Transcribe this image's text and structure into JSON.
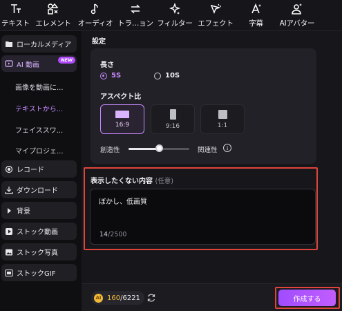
{
  "toolbar": {
    "items": [
      {
        "label": "テキスト",
        "icon": "text-icon"
      },
      {
        "label": "エレメント",
        "icon": "elements-icon"
      },
      {
        "label": "オーディオ",
        "icon": "music-note-icon"
      },
      {
        "label": "トラ…ョン",
        "icon": "transition-icon"
      },
      {
        "label": "フィルター",
        "icon": "sparkle-icon"
      },
      {
        "label": "エフェクト",
        "icon": "effect-icon"
      },
      {
        "label": "字幕",
        "icon": "caption-icon"
      },
      {
        "label": "AIアバター",
        "icon": "avatar-icon"
      }
    ]
  },
  "sidebar": {
    "items": [
      {
        "label": "ローカルメディア",
        "icon": "folder-icon"
      },
      {
        "label": "AI 動画",
        "icon": "ai-video-icon",
        "badge": "NEW"
      },
      {
        "label": "レコード",
        "icon": "record-icon"
      },
      {
        "label": "ダウンロード",
        "icon": "download-icon"
      },
      {
        "label": "背景",
        "icon": "caret-right-icon"
      },
      {
        "label": "ストック動画",
        "icon": "play-icon"
      },
      {
        "label": "ストック写真",
        "icon": "image-icon"
      },
      {
        "label": "ストックGIF",
        "icon": "gif-icon"
      }
    ],
    "subitems": [
      {
        "label": "画像を動画に..."
      },
      {
        "label": "テキストから..."
      },
      {
        "label": "フェイススワ..."
      },
      {
        "label": "マイプロジェ..."
      }
    ]
  },
  "settings": {
    "section_title": "設定",
    "length_label": "長さ",
    "length_options": [
      "5S",
      "10S"
    ],
    "aspect_label": "アスペクト比",
    "aspect_options": [
      "16:9",
      "9:16",
      "1:1"
    ],
    "creativity_label": "創造性",
    "relevance_label": "関連性",
    "slider_value": 0.5
  },
  "negative": {
    "title": "表示したくない内容",
    "optional": "(任意)",
    "value": "ぼかし、低画質",
    "count_current": "14",
    "count_max": "/2500"
  },
  "footer": {
    "credits_used": "160",
    "credits_total": "/6221",
    "create_label": "作成する"
  },
  "colors": {
    "accent": "#c98bff",
    "highlight": "#e0453c",
    "coin": "#f0b93a"
  }
}
